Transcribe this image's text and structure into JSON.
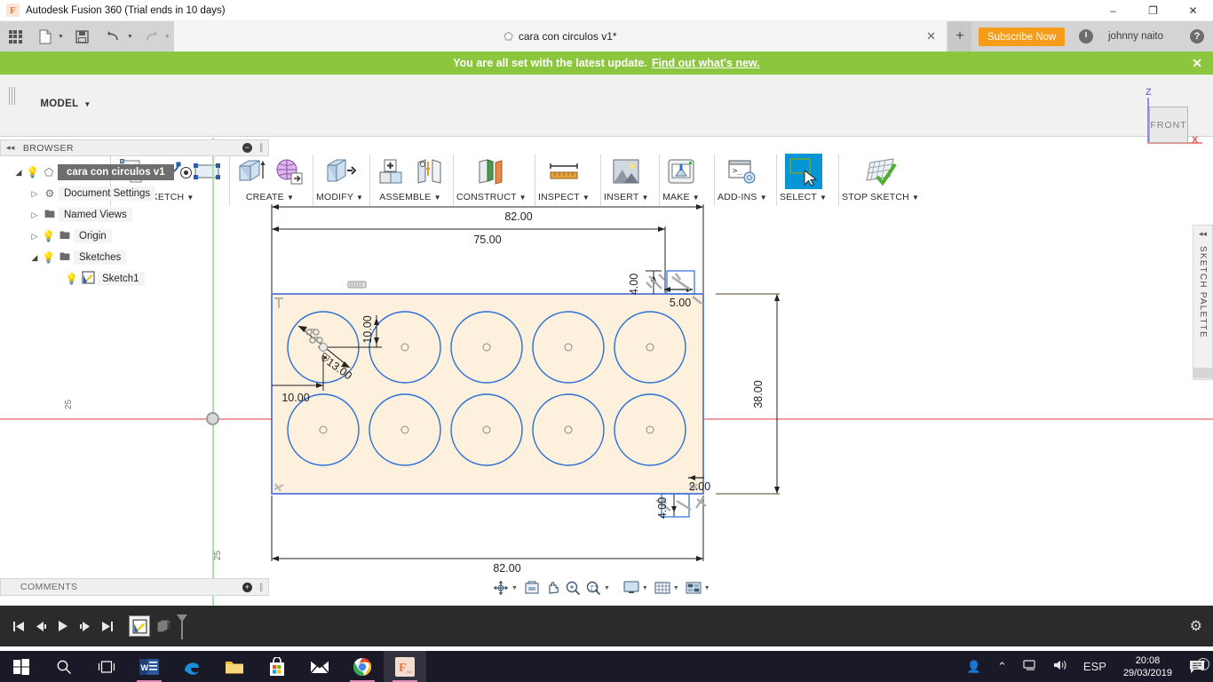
{
  "titlebar": {
    "app_title": "Autodesk Fusion 360 (Trial ends in 10 days)",
    "logo_letter": "F",
    "minimize": "–",
    "maximize": "❐",
    "close": "✕"
  },
  "approw": {
    "tab_title": "cara con circulos v1*",
    "tab_close": "✕",
    "tab_plus": "+",
    "subscribe_label": "Subscribe Now",
    "username": "johnny naito",
    "help_label": "?"
  },
  "banner": {
    "message": "You are all set with the latest update.",
    "link": "Find out what's new.",
    "close": "✕"
  },
  "ribbon": {
    "workspace_label": "MODEL",
    "workspace_caret": "▼",
    "groups": [
      {
        "label": "SKETCH",
        "caret": "▼"
      },
      {
        "label": "CREATE",
        "caret": "▼"
      },
      {
        "label": "MODIFY",
        "caret": "▼"
      },
      {
        "label": "ASSEMBLE",
        "caret": "▼"
      },
      {
        "label": "CONSTRUCT",
        "caret": "▼"
      },
      {
        "label": "INSPECT",
        "caret": "▼"
      },
      {
        "label": "INSERT",
        "caret": "▼"
      },
      {
        "label": "MAKE",
        "caret": "▼"
      },
      {
        "label": "ADD-INS",
        "caret": "▼"
      },
      {
        "label": "SELECT",
        "caret": "▼"
      },
      {
        "label": "STOP SKETCH",
        "caret": "▼"
      }
    ]
  },
  "browser": {
    "title": "BROWSER",
    "collapse": "◂◂",
    "minus": "−",
    "tree": [
      {
        "label": "cara con circulos v1",
        "arrow": "◢",
        "bulb": "Ὂ1"
      },
      {
        "label": "Document Settings",
        "arrow": "▷"
      },
      {
        "label": "Named Views",
        "arrow": "▷"
      },
      {
        "label": "Origin",
        "arrow": "▷"
      },
      {
        "label": "Sketches",
        "arrow": "◢"
      },
      {
        "label": "Sketch1",
        "arrow": ""
      }
    ]
  },
  "comments": {
    "title": "COMMENTS",
    "plus": "+"
  },
  "canvas": {
    "axis_label_left": "25",
    "axis_label_bottom": "25",
    "view_cube_face": "FRONT",
    "axis_z": "Z",
    "axis_x": "X"
  },
  "sketch_dimensions": {
    "width_outer_top": "82.00",
    "width_inner_top": "75.00",
    "width_bottom": "82.00",
    "height_right": "38.00",
    "offset_top_small": "4.00",
    "offset_top_right": "5.00",
    "offset_bottom_small": "4.00",
    "offset_bottom_right": "2.00",
    "circle_vertical": "10.00",
    "circle_horizontal": "10.00",
    "circle_diameter": "⌸13.00"
  },
  "palette": {
    "title": "SKETCH PALETTE",
    "collapse": "◂◂"
  },
  "navbar": {
    "items": [
      "orbit-icon",
      "look-at-icon",
      "pan-icon",
      "zoom-icon",
      "zoom-window-icon",
      "display-settings-icon",
      "grid-snap-icon",
      "viewports-icon"
    ],
    "caret": "▾"
  },
  "timeline": {
    "buttons": [
      "go-to-beginning",
      "step-back",
      "play",
      "step-forward",
      "go-to-end"
    ],
    "gear": "⚙"
  },
  "taskbar": {
    "items": [
      "start-icon",
      "search-icon",
      "task-view-icon",
      "word-icon",
      "edge-icon",
      "explorer-icon",
      "store-icon",
      "mail-icon",
      "chrome-icon",
      "fusion360-icon"
    ],
    "people_icon": "὆4",
    "chevron_up": "⌃",
    "network_icon": "὚5",
    "volume_icon": "ὐA",
    "language": "ESP",
    "time": "20:08",
    "date": "29/03/2019",
    "notification_count": "7"
  },
  "colors": {
    "banner_green": "#8cc63e",
    "subscribe_orange": "#f59c1a",
    "select_blue": "#0696d7",
    "sketch_fill": "#fdf0dc",
    "sketch_line_blue": "#2b4fd8",
    "circle_blue": "#2b6fd8",
    "axis_x_red": "#f0a0a0",
    "axis_y_green": "#a8e6a8",
    "taskbar_dark": "#191927",
    "timeline_dark": "#2b2b2b"
  }
}
